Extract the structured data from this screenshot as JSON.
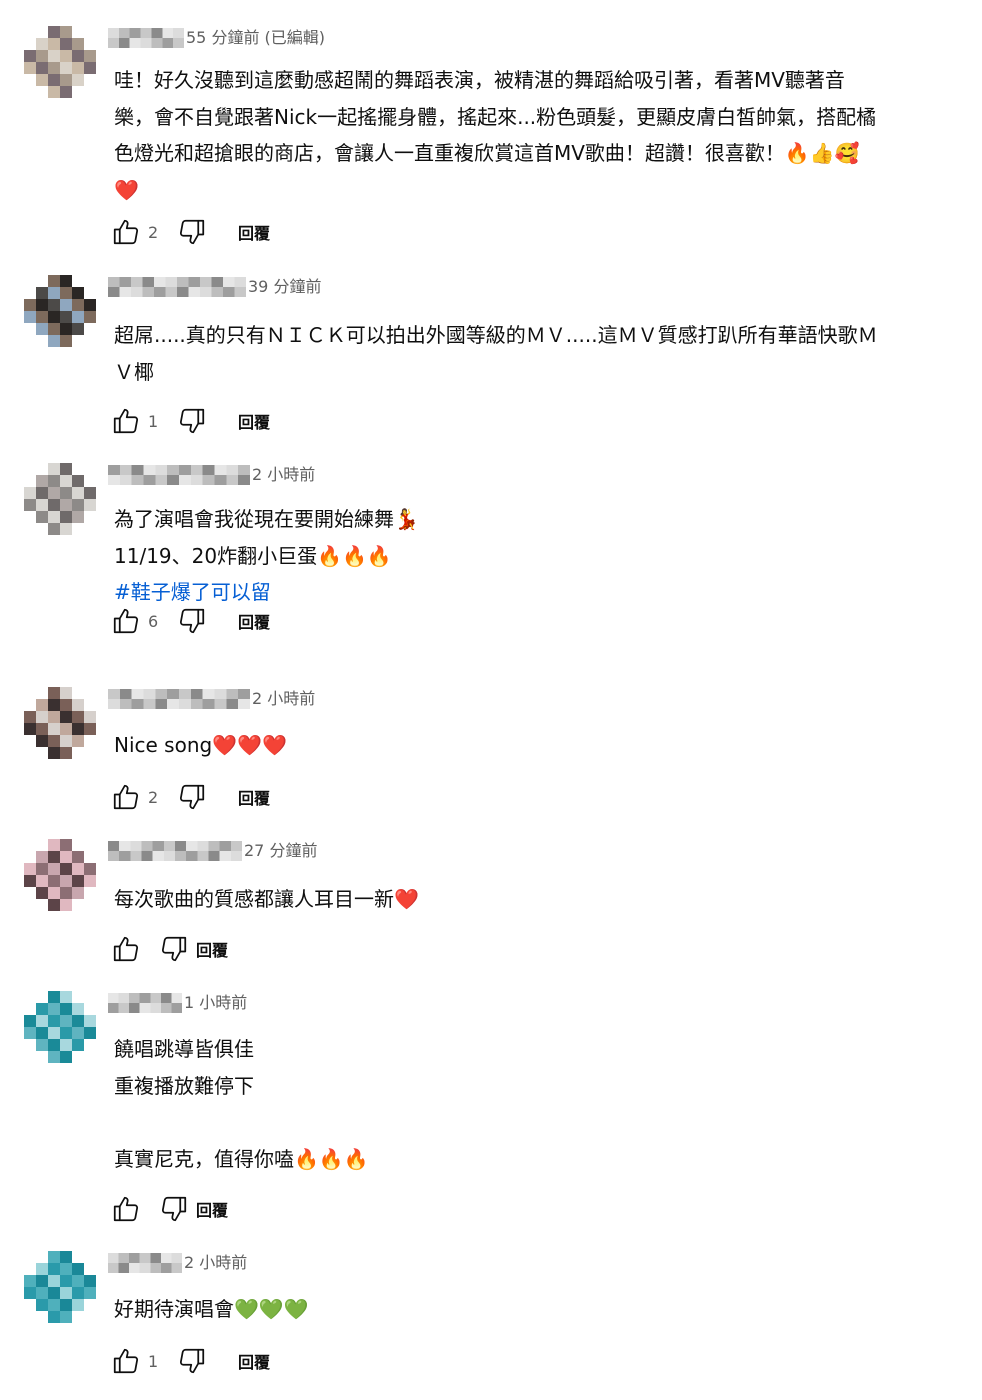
{
  "comments": [
    {
      "time": "55 分鐘前 (已編輯)",
      "lines": [
        "哇！好久沒聽到這麼動感超鬧的舞蹈表演，被精湛的舞蹈給吸引著，看著MV聽著音",
        "樂，會不自覺跟著Nick一起搖擺身體，搖起來...粉色頭髮，更顯皮膚白皙帥氣，搭配橘",
        "色燈光和超搶眼的商店，會讓人一直重複欣賞這首MV歌曲！超讚！很喜歡！🔥👍🥰",
        "❤️"
      ],
      "likes": "2",
      "reply_label": "回覆"
    },
    {
      "time": "39 分鐘前",
      "lines": [
        "超屌.....真的只有ＮＩＣＫ可以拍出外國等級的ＭＶ.....這ＭＶ質感打趴所有華語快歌Ｍ",
        "Ｖ椰"
      ],
      "likes": "1",
      "reply_label": "回覆"
    },
    {
      "time": "2 小時前",
      "lines": [
        "為了演唱會我從現在要開始練舞💃",
        "11/19、20炸翻小巨蛋🔥🔥🔥"
      ],
      "hashtag": "#鞋子爆了可以留",
      "likes": "6",
      "reply_label": "回覆"
    },
    {
      "time": "2 小時前",
      "lines": [
        "Nice song❤️❤️❤️"
      ],
      "likes": "2",
      "reply_label": "回覆"
    },
    {
      "time": "27 分鐘前",
      "lines": [
        "每次歌曲的質感都讓人耳目一新❤️"
      ],
      "likes": "",
      "reply_label": "回覆"
    },
    {
      "time": "1 小時前",
      "lines": [
        "饒唱跳導皆俱佳",
        "重複播放難停下",
        "",
        "真實尼克，值得你嗑🔥🔥🔥"
      ],
      "likes": "",
      "reply_label": "回覆"
    },
    {
      "time": "2 小時前",
      "lines": [
        "好期待演唱會💚💚💚"
      ],
      "likes": "1",
      "reply_label": "回覆"
    }
  ],
  "avatar_palettes": [
    [
      "#d9d2c8",
      "#a89a8c",
      "#7a6c72",
      "#c9b9a6"
    ],
    [
      "#8fa7bf",
      "#4c4a48",
      "#2a2624",
      "#7d6a5c"
    ],
    [
      "#d8d6d2",
      "#8d8a88",
      "#b0a8a6",
      "#6f6a6a"
    ],
    [
      "#d6d0cc",
      "#7a6058",
      "#3a3030",
      "#c0a89c"
    ],
    [
      "#c8a6ae",
      "#8c6e74",
      "#e0b8c0",
      "#5c4448"
    ],
    [
      "#5fb4c0",
      "#2a9aa8",
      "#a8d8de",
      "#1a8a98"
    ],
    [
      "#4fb0bc",
      "#2a9aaa",
      "#9ad4da",
      "#1a8898"
    ]
  ],
  "icons": {
    "like": "thumbs-up-icon",
    "dislike": "thumbs-down-icon"
  }
}
